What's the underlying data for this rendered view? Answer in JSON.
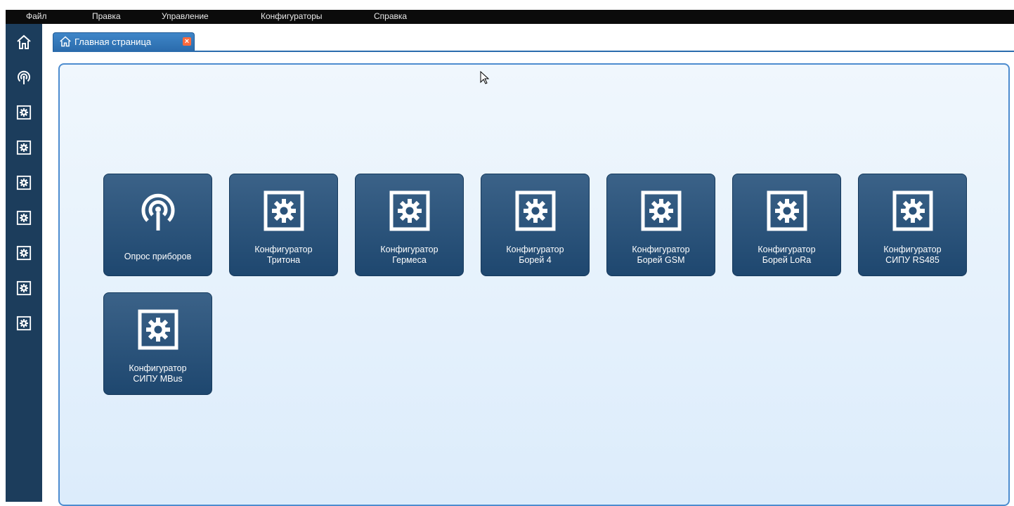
{
  "menu": {
    "items": [
      {
        "label": "Файл"
      },
      {
        "label": "Правка"
      },
      {
        "label": "Управление"
      },
      {
        "label": "Конфигураторы"
      },
      {
        "label": "Справка"
      }
    ]
  },
  "sidebar": {
    "items": [
      {
        "icon": "home-icon"
      },
      {
        "icon": "antenna-icon"
      },
      {
        "icon": "gear-box-icon"
      },
      {
        "icon": "gear-box-icon"
      },
      {
        "icon": "gear-box-icon"
      },
      {
        "icon": "gear-box-icon"
      },
      {
        "icon": "gear-box-icon"
      },
      {
        "icon": "gear-box-icon"
      },
      {
        "icon": "gear-box-icon"
      }
    ]
  },
  "tab": {
    "label": "Главная страница",
    "icon": "home-icon",
    "close": "×"
  },
  "tiles": [
    {
      "line1": "Опрос приборов",
      "line2": "",
      "icon": "antenna-icon"
    },
    {
      "line1": "Конфигуратор",
      "line2": "Тритона",
      "icon": "gear-box-icon"
    },
    {
      "line1": "Конфигуратор",
      "line2": "Гермеса",
      "icon": "gear-box-icon"
    },
    {
      "line1": "Конфигуратор",
      "line2": "Борей 4",
      "icon": "gear-box-icon"
    },
    {
      "line1": "Конфигуратор",
      "line2": "Борей GSM",
      "icon": "gear-box-icon"
    },
    {
      "line1": "Конфигуратор",
      "line2": "Борей LoRa",
      "icon": "gear-box-icon"
    },
    {
      "line1": "Конфигуратор",
      "line2": "СИПУ RS485",
      "icon": "gear-box-icon"
    },
    {
      "line1": "Конфигуратор",
      "line2": "СИПУ MBus",
      "icon": "gear-box-icon"
    }
  ],
  "colors": {
    "sidebar": "#1c3d5c",
    "tile": "#2a527a",
    "tab": "#2b6cad",
    "panel_border": "#4d8ccf",
    "close": "#ff6a3d"
  }
}
